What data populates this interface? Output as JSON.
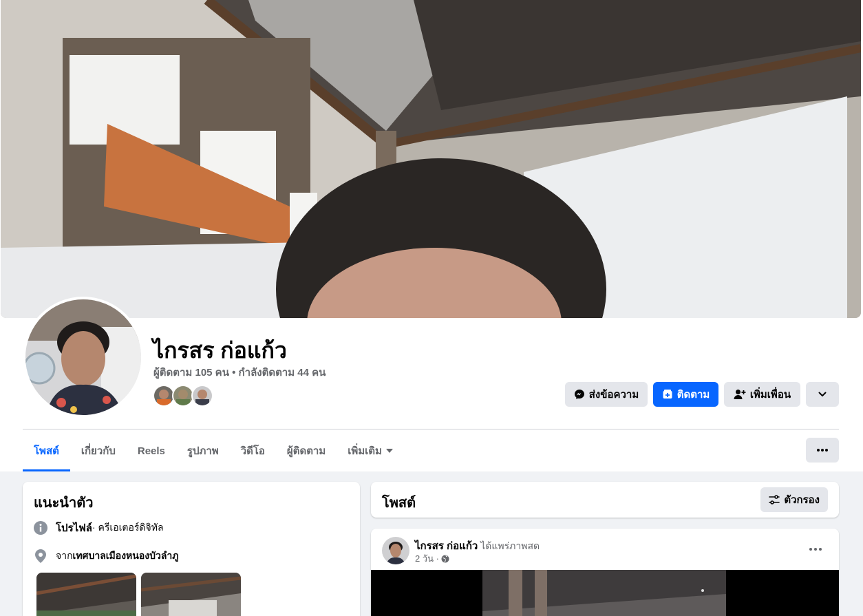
{
  "profile": {
    "name": "ไกรสร ก่อแก้ว",
    "follow_stats": "ผู้ติดตาม 105 คน • กำลังติดตาม 44 คน"
  },
  "actions": {
    "message_label": "ส่งข้อความ",
    "follow_label": "ติดตาม",
    "add_friend_label": "เพิ่มเพื่อน"
  },
  "tabs": [
    {
      "label": "โพสต์",
      "active": true
    },
    {
      "label": "เกี่ยวกับ"
    },
    {
      "label": "Reels"
    },
    {
      "label": "รูปภาพ"
    },
    {
      "label": "วิดีโอ"
    },
    {
      "label": "ผู้ติดตาม"
    },
    {
      "label": "เพิ่มเติม"
    }
  ],
  "intro": {
    "title": "แนะนำตัว",
    "profile_label": "โปรไฟล์",
    "profile_category": " · ครีเอเตอร์ดิจิทัล",
    "from_label": "จาก ",
    "from_place": "เทศบาลเมืองหนองบัวลำภู"
  },
  "posts": {
    "title": "โพสต์",
    "filter_label": "ตัวกรอง",
    "item": {
      "author": "ไกรสร ก่อแก้ว",
      "action": " ได้แพร่ภาพสด",
      "time": "2 วัน ·"
    }
  },
  "colors": {
    "accent": "#0866ff",
    "button_gray": "#e4e6eb",
    "muted_text": "#65676b",
    "page_bg": "#f0f2f5"
  }
}
